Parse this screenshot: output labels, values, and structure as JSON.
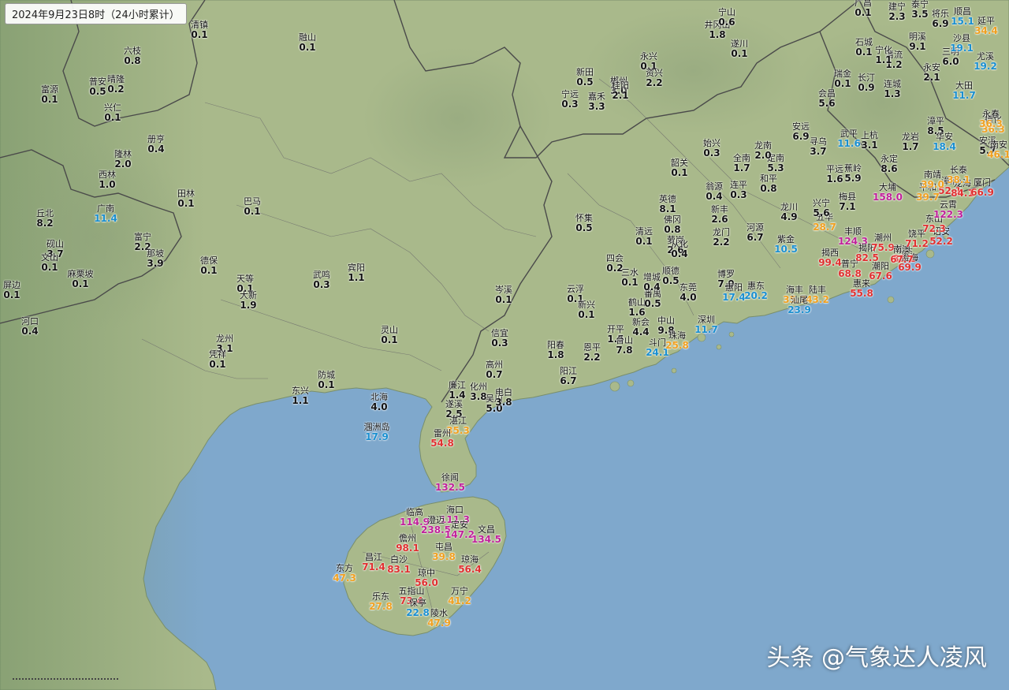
{
  "title": "2024年9月23日8时（24小时累计）",
  "watermark": "头条 @气象达人凌风",
  "colors": {
    "sea": "#7fa8cc",
    "land": "#a8b98a",
    "land_dark": "#7f9a6a",
    "border": "#555555",
    "value_light": "#111111",
    "value_10_25": "#1a8fd0",
    "value_25_50": "#f0a020",
    "value_50_100": "#e03030",
    "value_100_250": "#c0209a"
  },
  "stations": [
    {
      "name": "富源",
      "value": 0.1
    },
    {
      "name": "兴仁",
      "value": 0.1
    },
    {
      "name": "普安",
      "value": 0.5
    },
    {
      "name": "晴隆",
      "value": 0.2
    },
    {
      "name": "六枝",
      "value": 0.8
    },
    {
      "name": "册亨",
      "value": 0.4
    },
    {
      "name": "隆林",
      "value": 2.0
    },
    {
      "name": "西林",
      "value": 1.0
    },
    {
      "name": "田林",
      "value": 0.1
    },
    {
      "name": "广南",
      "value": 11.4
    },
    {
      "name": "丘北",
      "value": 8.2
    },
    {
      "name": "砚山",
      "value": 3.7
    },
    {
      "name": "文山",
      "value": 0.1
    },
    {
      "name": "富宁",
      "value": 2.2
    },
    {
      "name": "那坡",
      "value": 3.9
    },
    {
      "name": "麻栗坡",
      "value": 0.1
    },
    {
      "name": "屏边",
      "value": 0.1
    },
    {
      "name": "河口",
      "value": 0.4
    },
    {
      "name": "德保",
      "value": 0.1
    },
    {
      "name": "天等",
      "value": 0.1
    },
    {
      "name": "大新",
      "value": 1.9
    },
    {
      "name": "龙州",
      "value": 3.1
    },
    {
      "name": "凭祥",
      "value": 0.1
    },
    {
      "name": "巴马",
      "value": 0.1
    },
    {
      "name": "武鸣",
      "value": 0.3
    },
    {
      "name": "宾阳",
      "value": 1.1
    },
    {
      "name": "灵山",
      "value": 0.1
    },
    {
      "name": "防城",
      "value": 0.1
    },
    {
      "name": "东兴",
      "value": 1.1
    },
    {
      "name": "北海",
      "value": 4.0
    },
    {
      "name": "涠洲岛",
      "value": 17.9
    },
    {
      "name": "清镇",
      "value": 0.1
    },
    {
      "name": "融山",
      "value": 0.1
    },
    {
      "name": "岑溪",
      "value": 0.1
    },
    {
      "name": "信宜",
      "value": 0.3
    },
    {
      "name": "高州",
      "value": 0.7
    },
    {
      "name": "化州",
      "value": 3.8
    },
    {
      "name": "廉江",
      "value": 1.4
    },
    {
      "name": "遂溪",
      "value": 2.5
    },
    {
      "name": "湛江",
      "value": 35.3
    },
    {
      "name": "吴川",
      "value": 5.0
    },
    {
      "name": "电白",
      "value": 3.8
    },
    {
      "name": "雷州",
      "value": 54.8
    },
    {
      "name": "徐闻",
      "value": 132.5
    },
    {
      "name": "阳春",
      "value": 1.8
    },
    {
      "name": "阳江",
      "value": 6.7
    },
    {
      "name": "恩平",
      "value": 2.2
    },
    {
      "name": "开平",
      "value": 1.5
    },
    {
      "name": "台山",
      "value": 7.8
    },
    {
      "name": "新会",
      "value": 4.4
    },
    {
      "name": "鹤山",
      "value": 1.6
    },
    {
      "name": "中山",
      "value": 9.8
    },
    {
      "name": "斗门",
      "value": 24.1
    },
    {
      "name": "珠海",
      "value": 25.8
    },
    {
      "name": "深圳",
      "value": 11.7
    },
    {
      "name": "东莞",
      "value": 4.0
    },
    {
      "name": "番禺",
      "value": 0.5
    },
    {
      "name": "顺德",
      "value": 0.5
    },
    {
      "name": "萝岗",
      "value": 2.6
    },
    {
      "name": "增城",
      "value": 0.4
    },
    {
      "name": "从化",
      "value": 0.4
    },
    {
      "name": "佛冈",
      "value": 0.8
    },
    {
      "name": "英德",
      "value": 8.1
    },
    {
      "name": "清远",
      "value": 0.1
    },
    {
      "name": "怀集",
      "value": 0.5
    },
    {
      "name": "四会",
      "value": 0.2
    },
    {
      "name": "三水",
      "value": 0.1
    },
    {
      "name": "云浮",
      "value": 0.1
    },
    {
      "name": "新兴",
      "value": 0.1
    },
    {
      "name": "博罗",
      "value": 7.0
    },
    {
      "name": "惠阳",
      "value": 17.4
    },
    {
      "name": "惠东",
      "value": 20.2
    },
    {
      "name": "海丰",
      "value": 35.7
    },
    {
      "name": "陆丰",
      "value": 43.2
    },
    {
      "name": "汕尾",
      "value": 23.9
    },
    {
      "name": "紫金",
      "value": 10.5
    },
    {
      "name": "河源",
      "value": 6.7
    },
    {
      "name": "龙门",
      "value": 2.2
    },
    {
      "name": "新丰",
      "value": 2.6
    },
    {
      "name": "翁源",
      "value": 0.4
    },
    {
      "name": "连平",
      "value": 0.3
    },
    {
      "name": "和平",
      "value": 0.8
    },
    {
      "name": "龙川",
      "value": 4.9
    },
    {
      "name": "五华",
      "value": 28.7
    },
    {
      "name": "兴宁",
      "value": 5.6
    },
    {
      "name": "梅县",
      "value": 7.1
    },
    {
      "name": "平远",
      "value": 1.6
    },
    {
      "name": "蕉岭",
      "value": 5.9
    },
    {
      "name": "大埔",
      "value": 158.0
    },
    {
      "name": "丰顺",
      "value": 124.3
    },
    {
      "name": "揭西",
      "value": 99.4
    },
    {
      "name": "普宁",
      "value": 68.8
    },
    {
      "name": "揭阳",
      "value": 82.5
    },
    {
      "name": "潮州",
      "value": 75.9
    },
    {
      "name": "潮阳",
      "value": 67.6
    },
    {
      "name": "惠来",
      "value": 55.8
    },
    {
      "name": "汕头",
      "value": 83.2
    },
    {
      "name": "澄海",
      "value": 69.9
    },
    {
      "name": "南澳",
      "value": 67.7
    },
    {
      "name": "饶平",
      "value": 71.2
    },
    {
      "name": "诏安",
      "value": 52.2
    },
    {
      "name": "东山",
      "value": 72.3
    },
    {
      "name": "云霄",
      "value": 122.3
    },
    {
      "name": "漳浦",
      "value": 52.1
    },
    {
      "name": "平和",
      "value": 39.7
    },
    {
      "name": "南靖",
      "value": 39.0
    },
    {
      "name": "龙海",
      "value": 84.1
    },
    {
      "name": "厦门",
      "value": 66.9
    },
    {
      "name": "长泰",
      "value": 38.1
    },
    {
      "name": "漳平",
      "value": 8.5
    },
    {
      "name": "华安",
      "value": 18.4
    },
    {
      "name": "安溪",
      "value": 5.7
    },
    {
      "name": "德化",
      "value": 36.3
    },
    {
      "name": "永春",
      "value": 36.3
    },
    {
      "name": "南安",
      "value": 46.1
    },
    {
      "name": "大田",
      "value": 11.7
    },
    {
      "name": "永安",
      "value": 2.1
    },
    {
      "name": "三明",
      "value": 6.0
    },
    {
      "name": "沙县",
      "value": 19.1
    },
    {
      "name": "尤溪",
      "value": 19.2
    },
    {
      "name": "延平",
      "value": 34.4
    },
    {
      "name": "顺昌",
      "value": 15.1
    },
    {
      "name": "将乐",
      "value": 6.9
    },
    {
      "name": "泰宁",
      "value": 3.5
    },
    {
      "name": "建宁",
      "value": 2.3
    },
    {
      "name": "明溪",
      "value": 9.1
    },
    {
      "name": "清流",
      "value": 1.2
    },
    {
      "name": "宁化",
      "value": 1.1
    },
    {
      "name": "石城",
      "value": 0.1
    },
    {
      "name": "广昌",
      "value": 0.1
    },
    {
      "name": "瑞金",
      "value": 0.1
    },
    {
      "name": "会昌",
      "value": 5.6
    },
    {
      "name": "长汀",
      "value": 0.9
    },
    {
      "name": "连城",
      "value": 1.3
    },
    {
      "name": "武平",
      "value": 11.6
    },
    {
      "name": "上杭",
      "value": 3.1
    },
    {
      "name": "龙岩",
      "value": 1.7
    },
    {
      "name": "永定",
      "value": 8.6
    },
    {
      "name": "安远",
      "value": 6.9
    },
    {
      "name": "寻乌",
      "value": 3.7
    },
    {
      "name": "定南",
      "value": 5.3
    },
    {
      "name": "龙南",
      "value": 2.0
    },
    {
      "name": "全南",
      "value": 1.7
    },
    {
      "name": "始兴",
      "value": 0.3
    },
    {
      "name": "韶关",
      "value": 0.1
    },
    {
      "name": "遂川",
      "value": 0.1
    },
    {
      "name": "井冈山",
      "value": 1.8
    },
    {
      "name": "宁山",
      "value": 0.6
    },
    {
      "name": "永兴",
      "value": 0.1
    },
    {
      "name": "资兴",
      "value": 2.2
    },
    {
      "name": "郴州",
      "value": 3.0
    },
    {
      "name": "新田",
      "value": 0.5
    },
    {
      "name": "宁远",
      "value": 0.3
    },
    {
      "name": "嘉禾",
      "value": 3.3
    },
    {
      "name": "桂阳",
      "value": 2.1
    },
    {
      "name": "海口",
      "value": 111.3
    },
    {
      "name": "临高",
      "value": 114.9
    },
    {
      "name": "澄迈",
      "value": 238.5
    },
    {
      "name": "定安",
      "value": 147.2
    },
    {
      "name": "文昌",
      "value": 134.5
    },
    {
      "name": "儋州",
      "value": 98.1
    },
    {
      "name": "屯昌",
      "value": 39.8
    },
    {
      "name": "琼海",
      "value": 56.4
    },
    {
      "name": "昌江",
      "value": 71.4
    },
    {
      "name": "白沙",
      "value": 83.1
    },
    {
      "name": "琼中",
      "value": 56.0
    },
    {
      "name": "东方",
      "value": 47.3
    },
    {
      "name": "五指山",
      "value": 73.4
    },
    {
      "name": "乐东",
      "value": 27.8
    },
    {
      "name": "保亭",
      "value": 22.8
    },
    {
      "name": "万宁",
      "value": 41.2
    },
    {
      "name": "陵水",
      "value": 47.9
    }
  ]
}
